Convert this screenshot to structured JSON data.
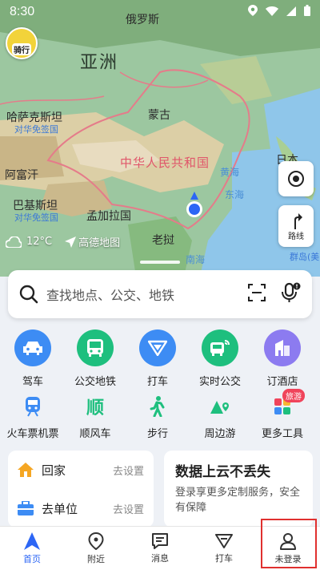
{
  "status_bar": {
    "time": "8:30"
  },
  "map": {
    "labels": {
      "russia": "俄罗斯",
      "asia": "亚洲",
      "kazakhstan": "哈萨克斯坦",
      "kazakhstan_visa": "对华免签国",
      "mongolia": "蒙古",
      "china": "中华人民共和国",
      "afghanistan": "阿富汗",
      "pakistan": "巴基斯坦",
      "pakistan_visa": "对华免签国",
      "bangladesh": "孟加拉国",
      "yellow_sea": "黄海",
      "east_sea": "东海",
      "south_sea": "南海",
      "japan": "日本",
      "laos": "老挝",
      "islands": "群岛(美"
    },
    "avatar_text": "骑行",
    "route_label": "路线",
    "weather_temp": "12°C",
    "map_brand": "高德地图"
  },
  "search": {
    "placeholder": "查找地点、公交、地铁"
  },
  "quick_actions": [
    {
      "label": "驾车",
      "color": "#3d8cf4",
      "icon": "car-icon"
    },
    {
      "label": "公交地铁",
      "color": "#1ebf7e",
      "icon": "bus-icon"
    },
    {
      "label": "打车",
      "color": "#3d8cf4",
      "icon": "taxi-icon"
    },
    {
      "label": "实时公交",
      "color": "#1ebf7e",
      "icon": "realtime-bus-icon"
    },
    {
      "label": "订酒店",
      "color": "#8c7bf0",
      "icon": "hotel-icon"
    }
  ],
  "secondary_actions": [
    {
      "label": "火车票机票",
      "icon": "train-icon"
    },
    {
      "label": "顺风车",
      "icon": "carpool-icon",
      "glyph": "顺"
    },
    {
      "label": "步行",
      "icon": "walk-icon"
    },
    {
      "label": "周边游",
      "icon": "nearby-travel-icon"
    },
    {
      "label": "更多工具",
      "icon": "more-tools-icon",
      "badge": "旅游"
    }
  ],
  "shortcuts": [
    {
      "label": "回家",
      "action": "去设置"
    },
    {
      "label": "去单位",
      "action": "去设置"
    }
  ],
  "promo": {
    "title": "数据上云不丢失",
    "desc": "登录享更多定制服务，安全有保障"
  },
  "tabs": [
    {
      "label": "首页"
    },
    {
      "label": "附近"
    },
    {
      "label": "消息"
    },
    {
      "label": "打车"
    },
    {
      "label": "未登录"
    }
  ],
  "colors": {
    "accent": "#2c66f5",
    "green": "#1ebf7e",
    "highlight": "#e0302f"
  }
}
